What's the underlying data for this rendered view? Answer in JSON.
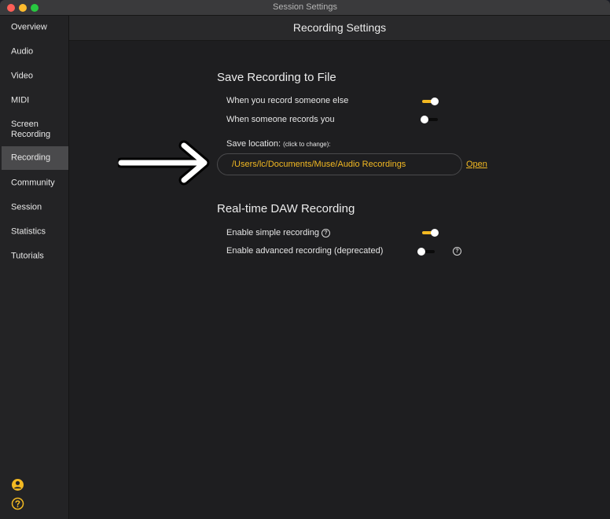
{
  "window": {
    "title": "Session Settings"
  },
  "sidebar": {
    "items": [
      {
        "label": "Overview"
      },
      {
        "label": "Audio"
      },
      {
        "label": "Video"
      },
      {
        "label": "MIDI"
      },
      {
        "label": "Screen Recording"
      },
      {
        "label": "Recording",
        "active": true
      },
      {
        "label": "Community"
      },
      {
        "label": "Session"
      },
      {
        "label": "Statistics"
      },
      {
        "label": "Tutorials"
      }
    ],
    "bottom_icons": [
      "account-icon",
      "help-icon"
    ]
  },
  "main": {
    "title": "Recording Settings",
    "save_section": {
      "title": "Save Recording to File",
      "rows": [
        {
          "label": "When you record someone else",
          "on": true
        },
        {
          "label": "When someone records you",
          "on": false
        }
      ],
      "location_label": "Save location:",
      "location_hint": "(click to change):",
      "path": "/Users/lc/Documents/Muse/Audio Recordings",
      "open_label": "Open"
    },
    "daw_section": {
      "title": "Real-time DAW Recording",
      "rows": [
        {
          "label": "Enable simple recording",
          "on": true,
          "help": true
        },
        {
          "label": "Enable advanced recording (deprecated)",
          "on": false,
          "help": true
        }
      ]
    }
  },
  "colors": {
    "accent": "#f3b922",
    "background": "#1e1e20",
    "sidebar_active": "#4a4a4c"
  }
}
